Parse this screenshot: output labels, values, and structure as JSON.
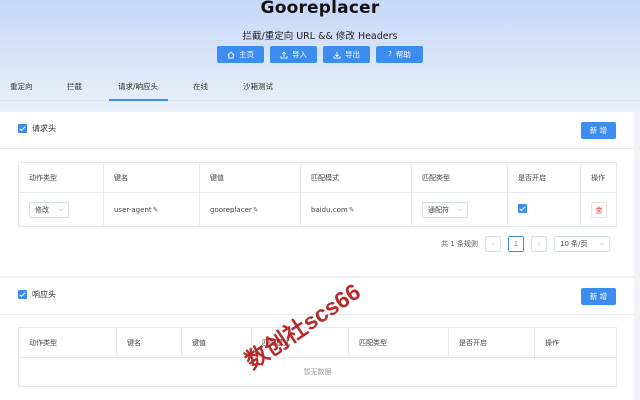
{
  "app": {
    "title": "Gooreplacer",
    "subtitle": "拦截/重定向 URL && 修改 Headers"
  },
  "toolbar": {
    "home_label": "主页",
    "import_label": "导入",
    "export_label": "导出",
    "help_label": "帮助"
  },
  "tabs": [
    {
      "label": "重定向"
    },
    {
      "label": "拦截"
    },
    {
      "label": "请求/响应头"
    },
    {
      "label": "在线"
    },
    {
      "label": "沙箱测试"
    }
  ],
  "request_headers": {
    "title": "请求头",
    "enabled": true,
    "add_label": "新 增",
    "columns": [
      "动作类型",
      "键名",
      "键值",
      "匹配模式",
      "匹配类型",
      "是否开启",
      "操作"
    ],
    "rows": [
      {
        "action": "修改",
        "key": "user-agent",
        "value": "gooreplacer",
        "pattern": "baidu.com",
        "match_type": "通配符",
        "enabled": true
      }
    ],
    "pagination": {
      "total_text": "共 1 条规则",
      "current_page": "1",
      "prev": "‹",
      "next": "›",
      "page_size": "10 条/页"
    }
  },
  "response_headers": {
    "title": "响应头",
    "enabled": true,
    "add_label": "新 增",
    "columns": [
      "动作类型",
      "键名",
      "键值",
      "匹配模式",
      "匹配类型",
      "是否开启",
      "操作"
    ],
    "empty_text": "暂无数据"
  },
  "watermark": "数创社scs66",
  "colors": {
    "primary": "#3d8cf0",
    "danger": "#e84a4a",
    "watermark": "#b01a1a"
  }
}
